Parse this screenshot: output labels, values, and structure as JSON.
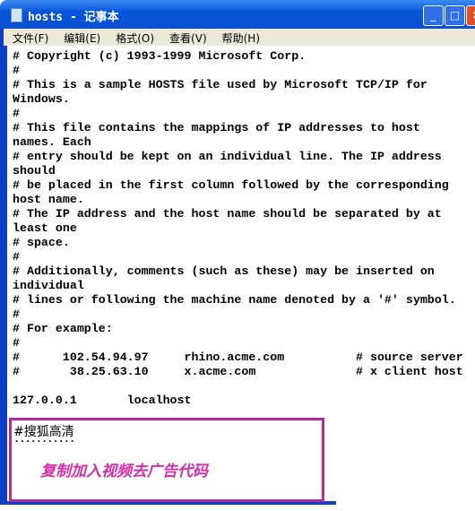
{
  "window": {
    "title": "hosts - 记事本",
    "minimize": "_",
    "maximize": "□",
    "close": "✕"
  },
  "menu": [
    "文件(F)",
    "编辑(E)",
    "格式(O)",
    "查看(V)",
    "帮助(H)"
  ],
  "content": "# Copyright (c) 1993-1999 Microsoft Corp.\n#\n# This is a sample HOSTS file used by Microsoft TCP/IP for\nWindows.\n#\n# This file contains the mappings of IP addresses to host\nnames. Each\n# entry should be kept on an individual line. The IP address\nshould\n# be placed in the first column followed by the corresponding\nhost name.\n# The IP address and the host name should be separated by at\nleast one\n# space.\n#\n# Additionally, comments (such as these) may be inserted on\nindividual\n# lines or following the machine name denoted by a '#' symbol.\n#\n# For example:\n#\n#      102.54.94.97     rhino.acme.com          # source server\n#       38.25.63.10     x.acme.com              # x client host\n\n127.0.0.1       localhost",
  "annotation": {
    "heading": "#搜狐高清",
    "dots": "...........",
    "note": "复制加入视频去广告代码",
    "color": "#b1289f"
  }
}
